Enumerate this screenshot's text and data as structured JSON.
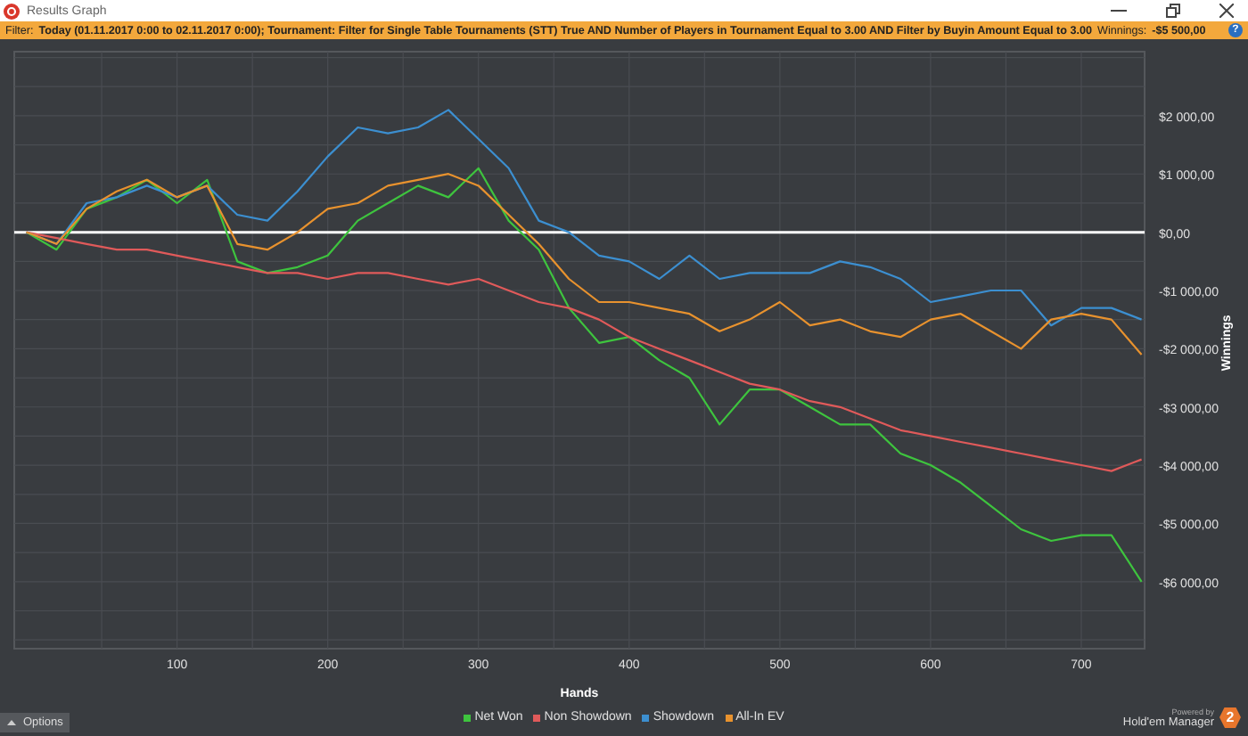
{
  "window": {
    "title": "Results Graph"
  },
  "filter_bar": {
    "label": "Filter:",
    "filter": "Today (01.11.2017 0:00 to 02.11.2017 0:00); Tournament: Filter for Single Table Tournaments (STT) True AND Number of Players in Tournament Equal to 3.00 AND Filter by Buyin Amount Equal to 3.00",
    "winnings_label": "Winnings:",
    "winnings_value": "-$5 500,00",
    "help": "?"
  },
  "chart": {
    "chart_data": {
      "type": "line",
      "xlabel": "Hands",
      "ylabel": "Winnings",
      "x": [
        0,
        20,
        40,
        60,
        80,
        100,
        120,
        140,
        160,
        180,
        200,
        220,
        240,
        260,
        280,
        300,
        320,
        340,
        360,
        380,
        400,
        420,
        440,
        460,
        480,
        500,
        520,
        540,
        560,
        580,
        600,
        620,
        640,
        660,
        680,
        700,
        720,
        740
      ],
      "series": [
        {
          "name": "Net Won",
          "color": "#3ec43e",
          "values": [
            0,
            -300,
            400,
            600,
            900,
            500,
            900,
            -500,
            -700,
            -600,
            -400,
            200,
            500,
            800,
            600,
            1100,
            200,
            -300,
            -1300,
            -1900,
            -1800,
            -2200,
            -2500,
            -3300,
            -2700,
            -2700,
            -3000,
            -3300,
            -3300,
            -3800,
            -4000,
            -4300,
            -4700,
            -5100,
            -5300,
            -5200,
            -5200,
            -6000
          ]
        },
        {
          "name": "Non Showdown",
          "color": "#e05a5a",
          "values": [
            0,
            -100,
            -200,
            -300,
            -300,
            -400,
            -500,
            -600,
            -700,
            -700,
            -800,
            -700,
            -700,
            -800,
            -900,
            -800,
            -1000,
            -1200,
            -1300,
            -1500,
            -1800,
            -2000,
            -2200,
            -2400,
            -2600,
            -2700,
            -2900,
            -3000,
            -3200,
            -3400,
            -3500,
            -3600,
            -3700,
            -3800,
            -3900,
            -4000,
            -4100,
            -3900
          ]
        },
        {
          "name": "Showdown",
          "color": "#3c8fd0",
          "values": [
            0,
            -200,
            500,
            600,
            800,
            600,
            800,
            300,
            200,
            700,
            1300,
            1800,
            1700,
            1800,
            2100,
            1600,
            1100,
            200,
            0,
            -400,
            -500,
            -800,
            -400,
            -800,
            -700,
            -700,
            -700,
            -500,
            -600,
            -800,
            -1200,
            -1100,
            -1000,
            -1000,
            -1600,
            -1300,
            -1300,
            -1500
          ]
        },
        {
          "name": "All-In EV",
          "color": "#e8922e",
          "values": [
            0,
            -200,
            400,
            700,
            900,
            600,
            800,
            -200,
            -300,
            0,
            400,
            500,
            800,
            900,
            1000,
            800,
            300,
            -200,
            -800,
            -1200,
            -1200,
            -1300,
            -1400,
            -1700,
            -1500,
            -1200,
            -1600,
            -1500,
            -1700,
            -1800,
            -1500,
            -1400,
            -1700,
            -2000,
            -1500,
            -1400,
            -1500,
            -2100
          ]
        }
      ],
      "xlim": [
        -8,
        742
      ],
      "grid": true,
      "ylim": [
        -7150,
        3100
      ],
      "xticks": [
        100,
        200,
        300,
        400,
        500,
        600,
        700
      ],
      "yticks": [
        {
          "value": 2000,
          "label": "$2 000,00"
        },
        {
          "value": 1000,
          "label": "$1 000,00"
        },
        {
          "value": 0,
          "label": "$0,00"
        },
        {
          "value": -1000,
          "label": "-$1 000,00"
        },
        {
          "value": -2000,
          "label": "-$2 000,00"
        },
        {
          "value": -3000,
          "label": "-$3 000,00"
        },
        {
          "value": -4000,
          "label": "-$4 000,00"
        },
        {
          "value": -5000,
          "label": "-$5 000,00"
        },
        {
          "value": -6000,
          "label": "-$6 000,00"
        }
      ]
    }
  },
  "footer": {
    "options_button": "Options",
    "powered_by": "Powered by",
    "brand": "Hold'em Manager",
    "brand_badge": "2"
  }
}
